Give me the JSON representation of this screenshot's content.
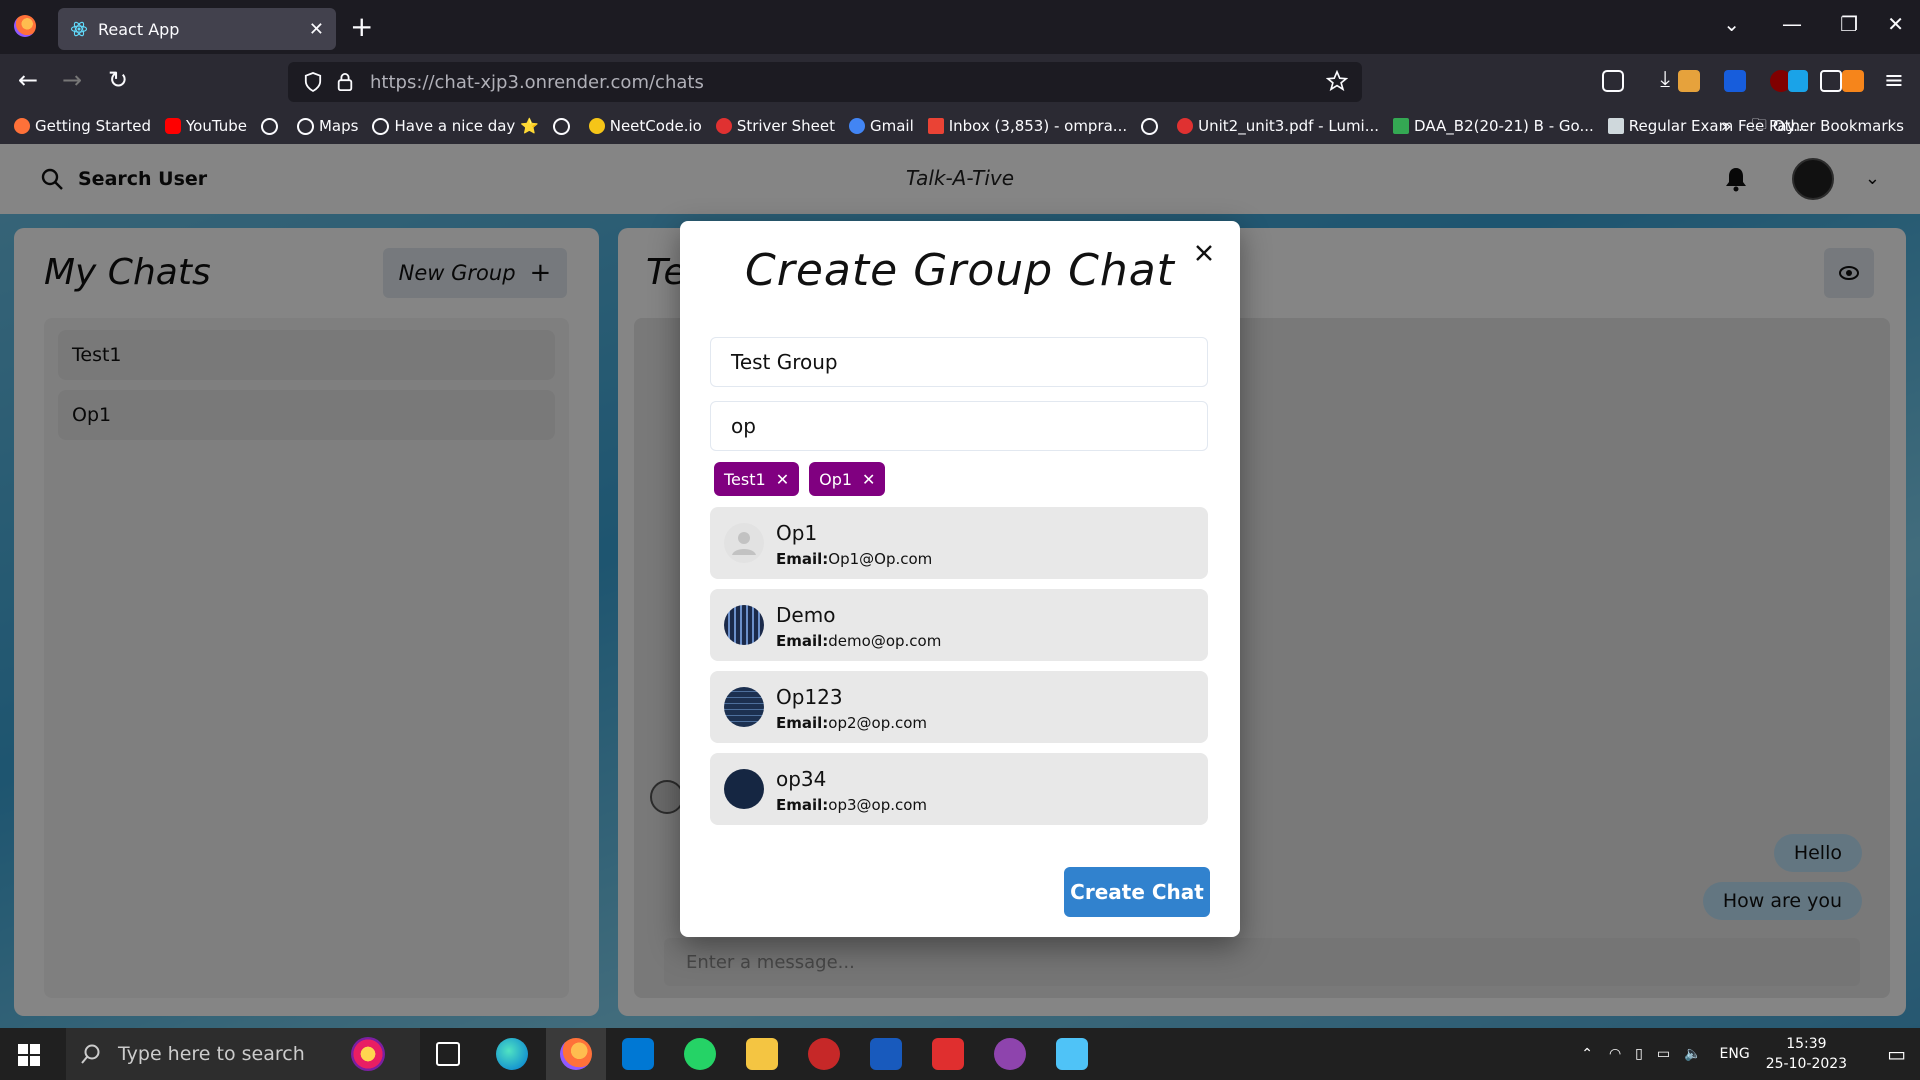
{
  "browser": {
    "tab_title": "React App",
    "url_host": "https://chat-xjp3.onrender.com",
    "url_path": "/chats",
    "bookmarks": [
      {
        "label": "Getting Started",
        "color": "#ff7139"
      },
      {
        "label": "YouTube",
        "color": "#ff0000"
      },
      {
        "label": "",
        "color": ""
      },
      {
        "label": "Maps",
        "color": ""
      },
      {
        "label": "Have a nice day ⭐",
        "color": ""
      },
      {
        "label": "",
        "color": ""
      },
      {
        "label": "NeetCode.io",
        "color": "#f5c518"
      },
      {
        "label": "Striver Sheet",
        "color": "#e03131"
      },
      {
        "label": "Gmail",
        "color": "#4285f4"
      },
      {
        "label": "Inbox (3,853) - ompra...",
        "color": "#ea4335"
      },
      {
        "label": "",
        "color": ""
      },
      {
        "label": "Unit2_unit3.pdf - Lumi...",
        "color": "#e03131"
      },
      {
        "label": "DAA_B2(20-21) B - Go...",
        "color": "#34a853"
      },
      {
        "label": "Regular Exam Fee Pay...",
        "color": "#cfd8dc"
      }
    ],
    "other_bookmarks": "Other Bookmarks"
  },
  "app": {
    "search_label": "Search User",
    "brand": "Talk-A-Tive",
    "my_chats_title": "My Chats",
    "new_group_label": "New Group",
    "chats": [
      {
        "name": "Test1"
      },
      {
        "name": "Op1"
      }
    ],
    "chat_title": "Te",
    "messages": [
      {
        "text": "Hello"
      },
      {
        "text": "How are you"
      }
    ],
    "message_placeholder": "Enter a message..."
  },
  "modal": {
    "title": "Create Group Chat",
    "chat_name_value": "Test Group",
    "search_value": "op",
    "selected": [
      {
        "name": "Test1"
      },
      {
        "name": "Op1"
      }
    ],
    "results": [
      {
        "name": "Op1",
        "email_label": "Email:",
        "email": "Op1@Op.com",
        "avatar": "default"
      },
      {
        "name": "Demo",
        "email_label": "Email:",
        "email": "demo@op.com",
        "avatar": "grid"
      },
      {
        "name": "Op123",
        "email_label": "Email:",
        "email": "op2@op.com",
        "avatar": "lines"
      },
      {
        "name": "op34",
        "email_label": "Email:",
        "email": "op3@op.com",
        "avatar": "dark"
      }
    ],
    "create_label": "Create Chat",
    "accent_color": "#3182ce",
    "chip_color": "#800080"
  },
  "taskbar": {
    "search_placeholder": "Type here to search",
    "language": "ENG",
    "time": "15:39",
    "date": "25-10-2023"
  }
}
